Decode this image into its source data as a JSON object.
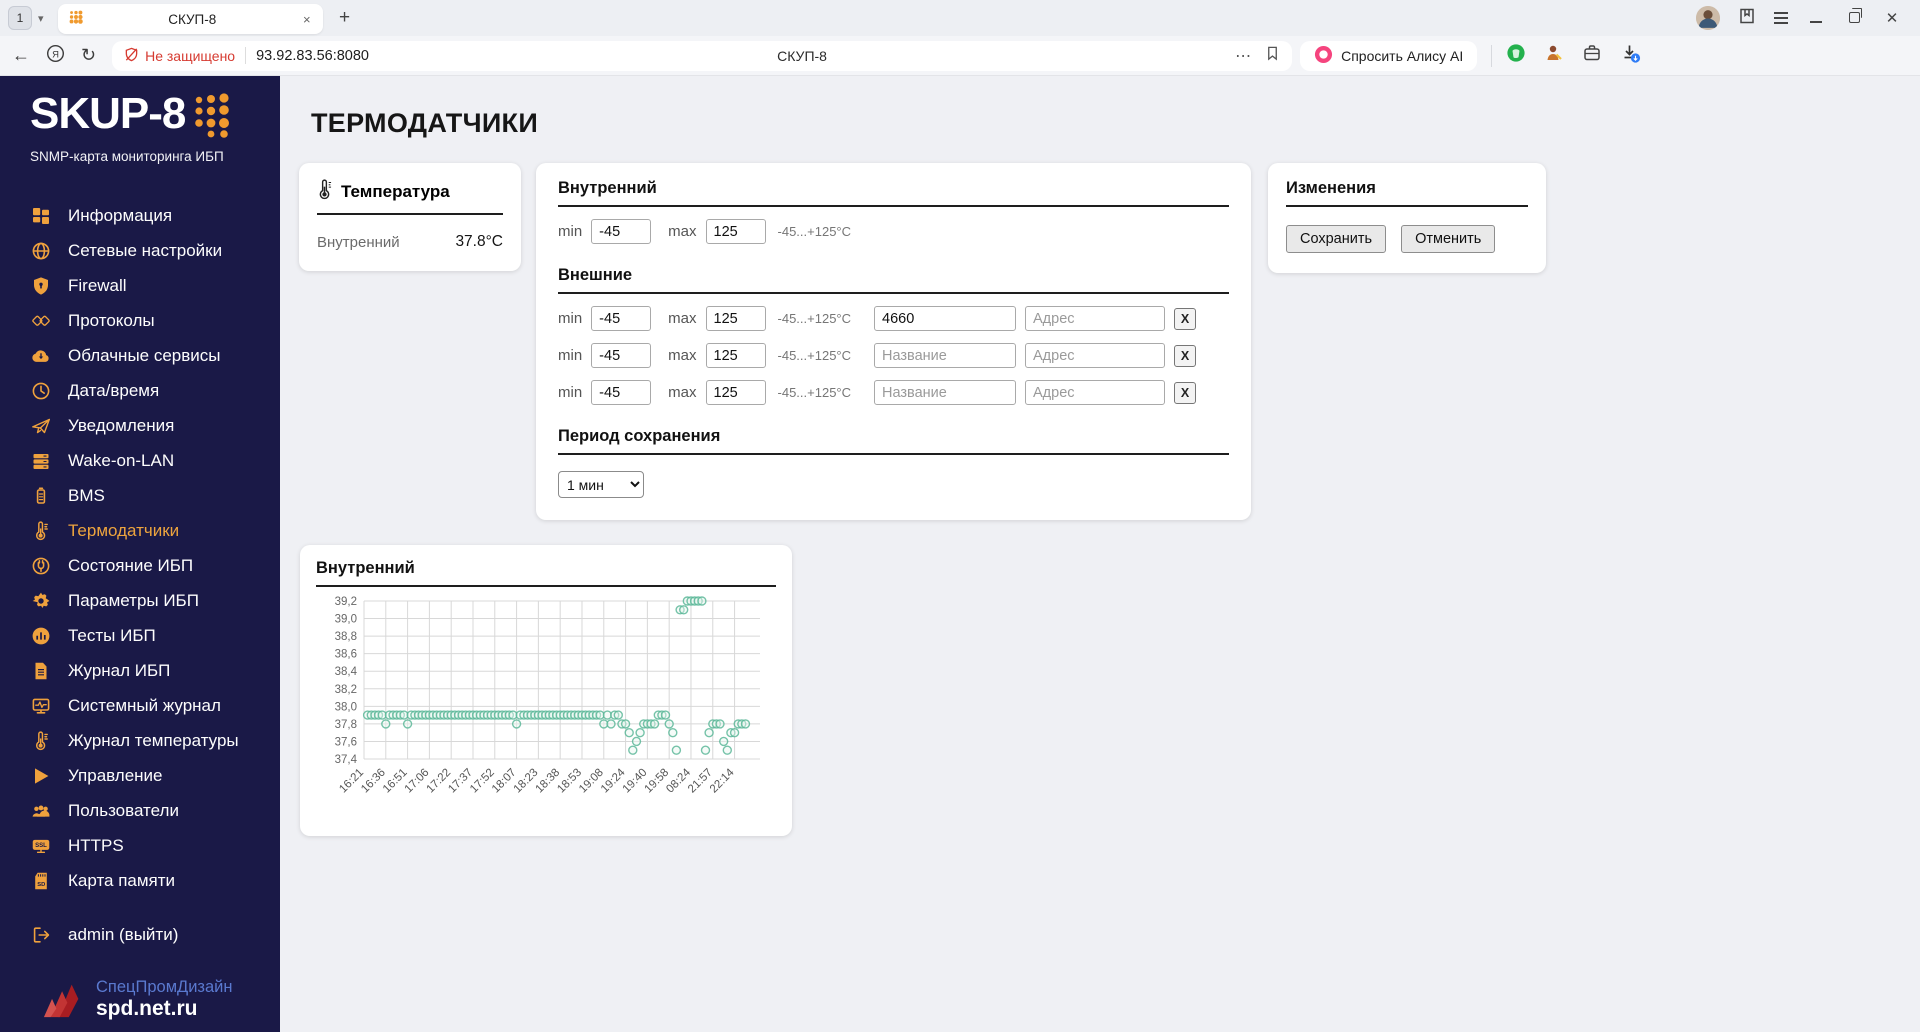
{
  "browser": {
    "tab_counter": "1",
    "tab_title": "СКУП-8",
    "new_tab_label": "+",
    "close_tab_label": "×",
    "security_warning": "Не защищено",
    "url": "93.92.83.56:8080",
    "page_title": "СКУП-8",
    "alice_button_label": "Спросить Алису AI",
    "more_label": "⋯"
  },
  "sidebar": {
    "logo_title": "SKUP-8",
    "logo_subtitle": "SNMP-карта мониторинга ИБП",
    "items": [
      {
        "id": "information",
        "label": "Информация",
        "icon": "grid-icon",
        "active": false
      },
      {
        "id": "network-settings",
        "label": "Сетевые настройки",
        "icon": "globe-icon",
        "active": false
      },
      {
        "id": "firewall",
        "label": "Firewall",
        "icon": "shield-icon",
        "active": false
      },
      {
        "id": "protocols",
        "label": "Протоколы",
        "icon": "protocols-icon",
        "active": false
      },
      {
        "id": "cloud-services",
        "label": "Облачные сервисы",
        "icon": "cloud-icon",
        "active": false
      },
      {
        "id": "date-time",
        "label": "Дата/время",
        "icon": "clock-icon",
        "active": false
      },
      {
        "id": "notifications",
        "label": "Уведомления",
        "icon": "paper-plane-icon",
        "active": false
      },
      {
        "id": "wake-on-lan",
        "label": "Wake-on-LAN",
        "icon": "server-icon",
        "active": false
      },
      {
        "id": "bms",
        "label": "BMS",
        "icon": "battery-icon",
        "active": false
      },
      {
        "id": "thermo-sensors",
        "label": "Термодатчики",
        "icon": "thermometer-icon",
        "active": true
      },
      {
        "id": "ups-status",
        "label": "Состояние ИБП",
        "icon": "plug-icon",
        "active": false
      },
      {
        "id": "ups-parameters",
        "label": "Параметры ИБП",
        "icon": "gear-icon",
        "active": false
      },
      {
        "id": "ups-tests",
        "label": "Тесты ИБП",
        "icon": "chart-circle-icon",
        "active": false
      },
      {
        "id": "ups-log",
        "label": "Журнал ИБП",
        "icon": "document-icon",
        "active": false
      },
      {
        "id": "system-log",
        "label": "Системный журнал",
        "icon": "monitor-pulse-icon",
        "active": false
      },
      {
        "id": "temperature-log",
        "label": "Журнал температуры",
        "icon": "thermometer-icon",
        "active": false
      },
      {
        "id": "control",
        "label": "Управление",
        "icon": "play-icon",
        "active": false
      },
      {
        "id": "users",
        "label": "Пользователи",
        "icon": "users-icon",
        "active": false
      },
      {
        "id": "https",
        "label": "HTTPS",
        "icon": "ssl-icon",
        "active": false
      },
      {
        "id": "memory-card",
        "label": "Карта памяти",
        "icon": "sd-card-icon",
        "active": false
      }
    ],
    "logout_item": {
      "id": "logout",
      "label": "admin (выйти)",
      "icon": "logout-icon"
    },
    "footer_logo_line1": "СпецПромДизайн",
    "footer_logo_line2": "spd.net.ru"
  },
  "page": {
    "title": "ТЕРМОДАТЧИКИ",
    "temperature_card": {
      "title": "Температура",
      "sensor_label": "Внутренний",
      "sensor_value": "37.8°C"
    },
    "settings_card": {
      "internal_section": {
        "title": "Внутренний",
        "min_label": "min",
        "min_value": "-45",
        "max_label": "max",
        "max_value": "125",
        "range_hint": "-45...+125°C"
      },
      "external_section": {
        "title": "Внешние",
        "rows": [
          {
            "min_label": "min",
            "min_value": "-45",
            "max_label": "max",
            "max_value": "125",
            "range_hint": "-45...+125°C",
            "name_value": "4660",
            "name_placeholder": "Название",
            "address_value": "",
            "address_placeholder": "Адрес",
            "remove_label": "X"
          },
          {
            "min_label": "min",
            "min_value": "-45",
            "max_label": "max",
            "max_value": "125",
            "range_hint": "-45...+125°C",
            "name_value": "",
            "name_placeholder": "Название",
            "address_value": "",
            "address_placeholder": "Адрес",
            "remove_label": "X"
          },
          {
            "min_label": "min",
            "min_value": "-45",
            "max_label": "max",
            "max_value": "125",
            "range_hint": "-45...+125°C",
            "name_value": "",
            "name_placeholder": "Название",
            "address_value": "",
            "address_placeholder": "Адрес",
            "remove_label": "X"
          }
        ]
      },
      "period_section": {
        "title": "Период сохранения",
        "selected_option": "1 мин"
      }
    },
    "changes_card": {
      "title": "Изменения",
      "save_label": "Сохранить",
      "cancel_label": "Отменить"
    },
    "chart_card": {
      "title": "Внутренний"
    }
  },
  "chart_data": {
    "type": "line",
    "title": "Внутренний",
    "ylim": [
      37.4,
      39.2
    ],
    "y_tick_step": 0.2,
    "grid": true,
    "x_tick_labels": [
      "16:21",
      "16:36",
      "16:51",
      "17:06",
      "17:22",
      "17:37",
      "17:52",
      "18:07",
      "18:23",
      "18:38",
      "18:53",
      "19:08",
      "19:24",
      "19:40",
      "19:58",
      "08:24",
      "21:57",
      "22:14"
    ],
    "points_per_tick": 6,
    "values": [
      37.9,
      37.9,
      37.9,
      37.9,
      37.9,
      37.9,
      37.8,
      37.9,
      37.9,
      37.9,
      37.9,
      37.9,
      37.8,
      37.9,
      37.9,
      37.9,
      37.9,
      37.9,
      37.9,
      37.9,
      37.9,
      37.9,
      37.9,
      37.9,
      37.9,
      37.9,
      37.9,
      37.9,
      37.9,
      37.9,
      37.9,
      37.9,
      37.9,
      37.9,
      37.9,
      37.9,
      37.9,
      37.9,
      37.9,
      37.9,
      37.9,
      37.9,
      37.8,
      37.9,
      37.9,
      37.9,
      37.9,
      37.9,
      37.9,
      37.9,
      37.9,
      37.9,
      37.9,
      37.9,
      37.9,
      37.9,
      37.9,
      37.9,
      37.9,
      37.9,
      37.9,
      37.9,
      37.9,
      37.9,
      37.9,
      37.9,
      37.8,
      37.9,
      37.8,
      37.9,
      37.9,
      37.8,
      37.8,
      37.7,
      37.5,
      37.6,
      37.7,
      37.8,
      37.8,
      37.8,
      37.8,
      37.9,
      37.9,
      37.9,
      37.8,
      37.7,
      37.5,
      39.1,
      39.1,
      39.2,
      39.2,
      39.2,
      39.2,
      39.2,
      37.5,
      37.7,
      37.8,
      37.8,
      37.8,
      37.6,
      37.5,
      37.7,
      37.7,
      37.8,
      37.8,
      37.8
    ]
  },
  "colors": {
    "accent_orange": "#efa13d",
    "sidebar_bg": "#1a1947",
    "active_item": "#eda43e",
    "chart_line": "#54b493",
    "warning_red": "#d63b31",
    "footer_blue": "#5a79cf"
  }
}
